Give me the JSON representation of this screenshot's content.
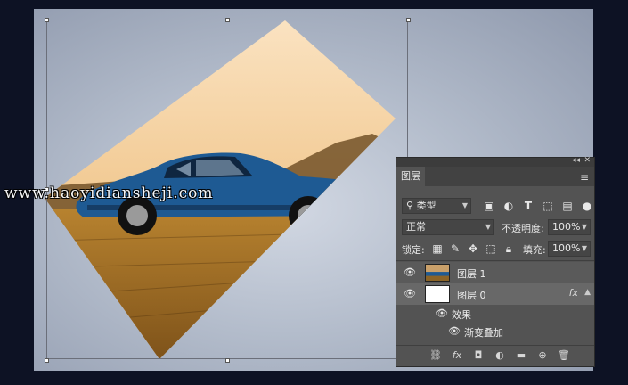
{
  "watermark": "www.haoyidiansheji.com",
  "layers_panel": {
    "title": "图层",
    "filter_type": "类型",
    "blend_mode": "正常",
    "opacity_label": "不透明度:",
    "opacity_value": "100%",
    "lock_label": "锁定:",
    "fill_label": "填充:",
    "fill_value": "100%",
    "layers": [
      {
        "name": "图层 1"
      },
      {
        "name": "图层 0",
        "fx": "fx"
      }
    ],
    "effects_label": "效果",
    "effect_item": "渐变叠加"
  }
}
